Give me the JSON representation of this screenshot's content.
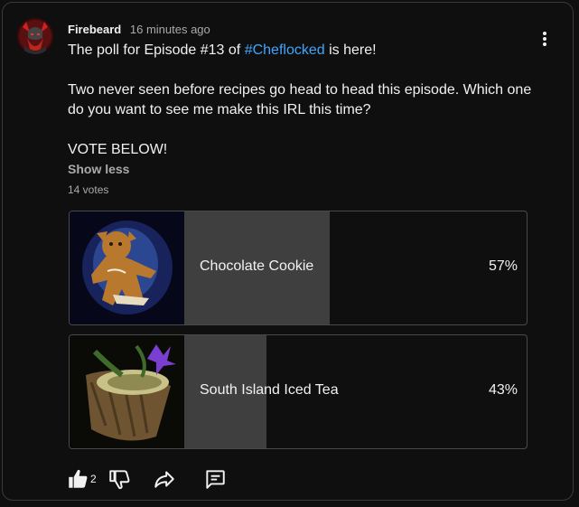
{
  "post": {
    "author": "Firebeard",
    "time": "16 minutes ago",
    "text_line1_pre": "The poll for Episode #13 of ",
    "hashtag": "#Cheflocked",
    "text_line1_post": " is here!",
    "text_para2": "Two never seen before recipes go head to head this episode. Which one do you want to see me make this IRL this time?",
    "text_para3": "VOTE BELOW!",
    "show_less": "Show less",
    "votes": "14 votes"
  },
  "poll": {
    "options": [
      {
        "label": "Chocolate Cookie",
        "percent_text": "57%",
        "fraction": 0.57
      },
      {
        "label": "South Island Iced Tea",
        "percent_text": "43%",
        "fraction": 0.43
      }
    ]
  },
  "actions": {
    "like_count": "2"
  },
  "icons": {
    "avatar": "dwarf-avatar-icon",
    "menu": "more-vertical-icon",
    "like": "thumbs-up-icon",
    "dislike": "thumbs-down-icon",
    "share": "share-icon",
    "comment": "comment-icon"
  },
  "colors": {
    "background": "#0f0f0f",
    "hashtag": "#3ea6ff",
    "poll_fill": "#3f3f3f",
    "border": "#4a4a4a"
  }
}
